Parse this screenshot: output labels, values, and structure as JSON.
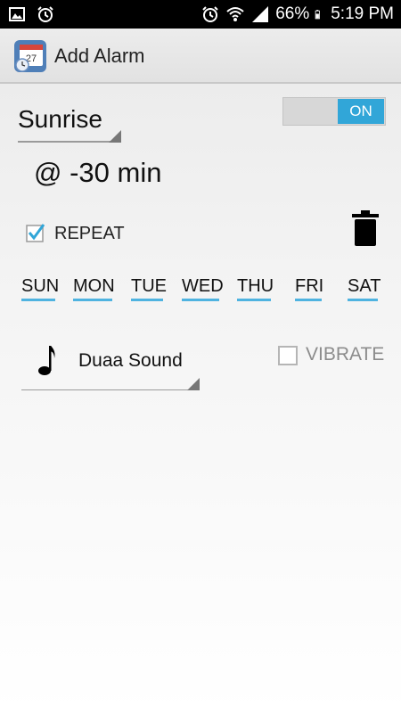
{
  "status_bar": {
    "battery": "66%",
    "time": "5:19 PM",
    "icons": [
      "image-icon",
      "alarm-icon",
      "alarm-icon",
      "wifi-icon",
      "signal-icon",
      "battery-icon"
    ]
  },
  "action_bar": {
    "title": "Add Alarm",
    "icon": "calendar-clock-icon"
  },
  "alarm": {
    "prayer": "Sunrise",
    "enabled_label": "ON",
    "offset": "@ -30 min",
    "repeat_label": "REPEAT",
    "repeat_checked": true,
    "days": [
      "SUN",
      "MON",
      "TUE",
      "WED",
      "THU",
      "FRI",
      "SAT"
    ],
    "sound": "Duaa Sound",
    "vibrate_label": "VIBRATE",
    "vibrate_checked": false
  },
  "colors": {
    "accent": "#31a6d8",
    "day_underline": "#4fb3e0",
    "status_bar": "#000000"
  }
}
